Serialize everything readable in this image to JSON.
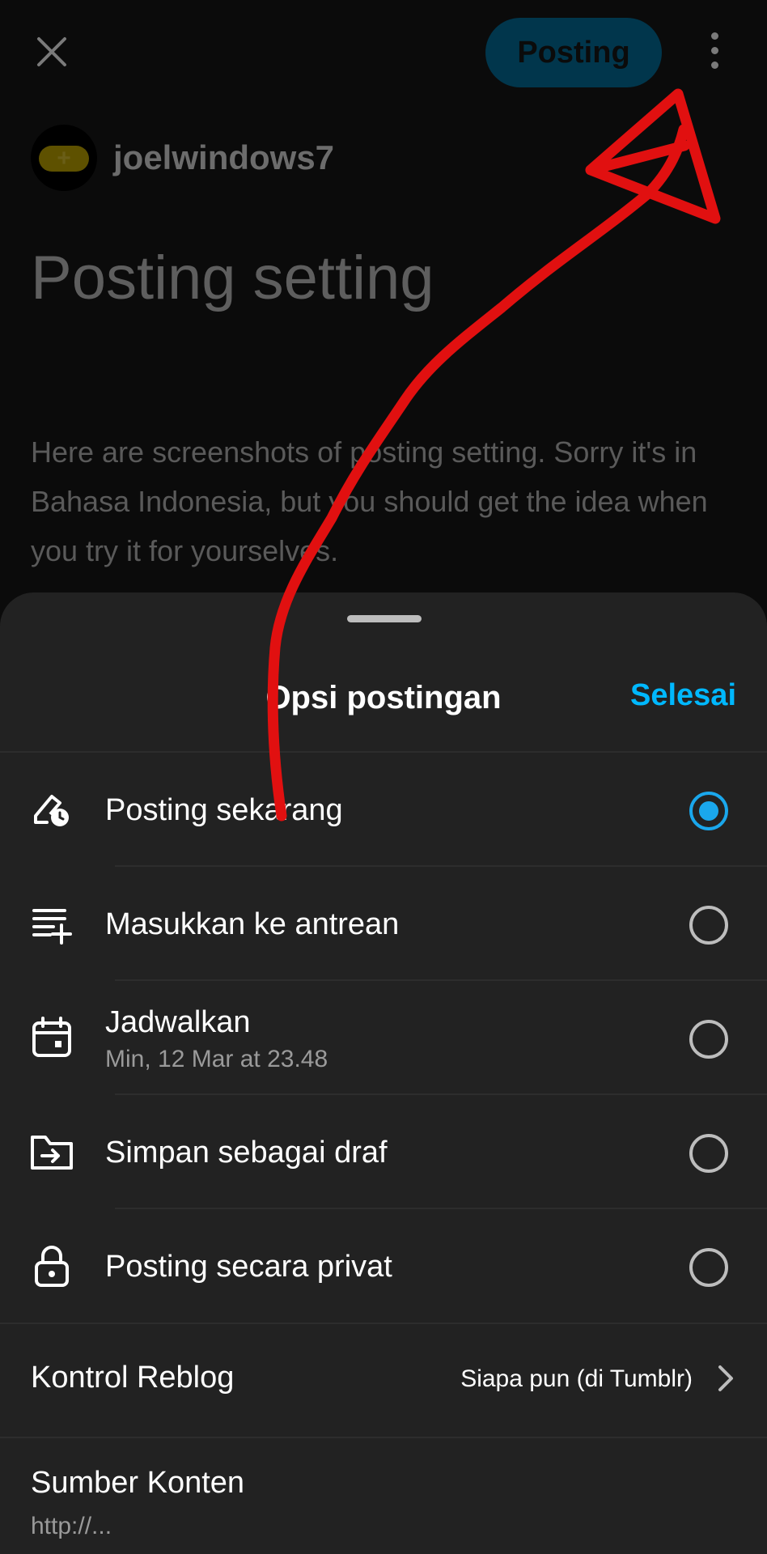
{
  "toolbar": {
    "post_button_label": "Posting"
  },
  "author": {
    "username": "joelwindows7"
  },
  "post": {
    "title": "Posting setting",
    "body": "Here are screenshots of posting setting. Sorry it's in Bahasa Indonesia, but you should get the idea when you try it for yourselves."
  },
  "sheet": {
    "title": "Opsi postingan",
    "done_label": "Selesai",
    "options": [
      {
        "label": "Posting sekarang",
        "selected": true,
        "icon": "post-now-icon"
      },
      {
        "label": "Masukkan ke antrean",
        "selected": false,
        "icon": "queue-add-icon"
      },
      {
        "label": "Jadwalkan",
        "sublabel": "Min, 12 Mar at 23.48",
        "selected": false,
        "icon": "calendar-icon"
      },
      {
        "label": "Simpan sebagai draf",
        "selected": false,
        "icon": "folder-draft-icon"
      },
      {
        "label": "Posting secara privat",
        "selected": false,
        "icon": "lock-icon"
      }
    ],
    "reblog": {
      "label": "Kontrol Reblog",
      "value": "Siapa pun (di Tumblr)"
    },
    "source": {
      "label": "Sumber Konten",
      "value": "http://..."
    }
  },
  "colors": {
    "accent": "#00b8ff",
    "radio_selected": "#1aa7ec",
    "post_button_bg": "#01364c",
    "annotation_stroke": "#e11010"
  }
}
